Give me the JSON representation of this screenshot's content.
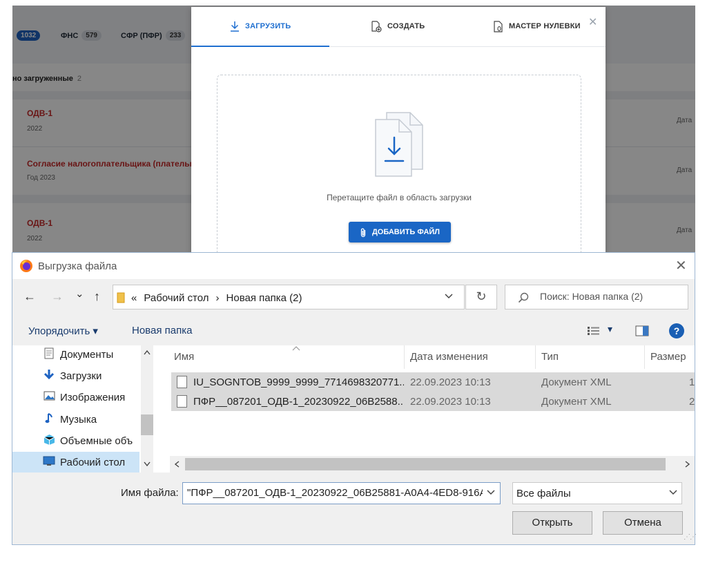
{
  "web_app": {
    "tabs": [
      {
        "label": "",
        "count": "1032"
      },
      {
        "label": "ФНС",
        "count": "579"
      },
      {
        "label": "СФР (ПФР)",
        "count": "233"
      }
    ],
    "section": {
      "label": "но загруженные",
      "count": "2"
    },
    "documents": [
      {
        "title": "ОДВ-1",
        "subtitle": "2022",
        "date_label": "Дата"
      },
      {
        "title": "Согласие налогоплательщика (плательщ",
        "subtitle": "Год 2023",
        "date_label": "Дата"
      },
      {
        "title": "ОДВ-1",
        "subtitle": "2022",
        "date_label": "Дата"
      }
    ]
  },
  "upload_modal": {
    "tabs": [
      {
        "label": "ЗАГРУЗИТЬ",
        "icon": "download-icon",
        "active": true
      },
      {
        "label": "СОЗДАТЬ",
        "icon": "new-document-icon",
        "active": false
      },
      {
        "label": "МАСТЕР НУЛЕВКИ",
        "icon": "zero-document-icon",
        "active": false
      }
    ],
    "close_glyph": "✕",
    "drop_hint": "Перетащите файл в область загрузки",
    "add_file_label": "ДОБАВИТЬ ФАЙЛ",
    "accent": "#1a66c5"
  },
  "file_dialog": {
    "title": "Выгрузка файла",
    "close_glyph": "✕",
    "nav": {
      "back": "←",
      "forward": "→",
      "recent": "⌄",
      "up": "↑",
      "refresh": "↻"
    },
    "address": {
      "prefix": "«",
      "segments": [
        "Рабочий стол",
        "Новая папка (2)"
      ],
      "separator": "›"
    },
    "search_placeholder": "Поиск: Новая папка (2)",
    "toolbar": {
      "organize": "Упорядочить ▾",
      "new_folder": "Новая папка",
      "view": "▾",
      "help": "?"
    },
    "nav_pane": [
      {
        "label": "Документы",
        "icon": "documents-icon",
        "selected": false
      },
      {
        "label": "Загрузки",
        "icon": "downloads-icon",
        "selected": false
      },
      {
        "label": "Изображения",
        "icon": "pictures-icon",
        "selected": false
      },
      {
        "label": "Музыка",
        "icon": "music-icon",
        "selected": false
      },
      {
        "label": "Объемные объ",
        "icon": "3d-objects-icon",
        "selected": false
      },
      {
        "label": "Рабочий стол",
        "icon": "desktop-icon",
        "selected": true
      }
    ],
    "columns": {
      "name": "Имя",
      "date": "Дата изменения",
      "type": "Тип",
      "size": "Размер"
    },
    "files": [
      {
        "name": "IU_SOGNTOB_9999_9999_7714698320771...",
        "date": "22.09.2023 10:13",
        "type": "Документ XML",
        "size": "1"
      },
      {
        "name": "ПФР__087201_ОДВ-1_20230922_06B2588...",
        "date": "22.09.2023 10:13",
        "type": "Документ XML",
        "size": "2"
      }
    ],
    "filename_label": "Имя файла:",
    "filename_value": "\"ПФР__087201_ОДВ-1_20230922_06B25881-A0A4-4ED8-916A",
    "filetype_value": "Все файлы",
    "open_label": "Открыть",
    "cancel_label": "Отмена"
  }
}
